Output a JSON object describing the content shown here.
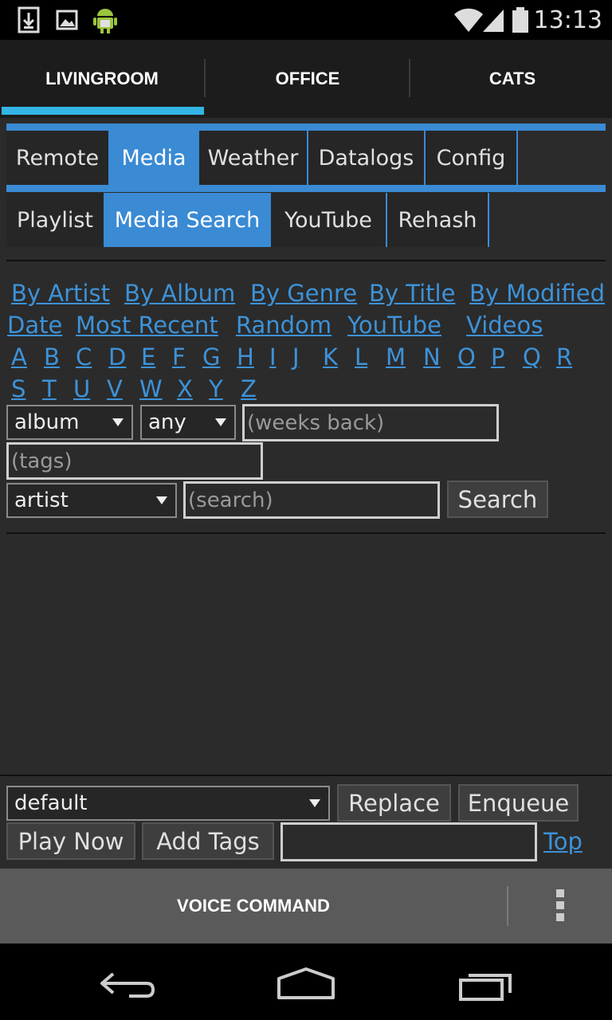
{
  "status_bar": {
    "time": "13:13",
    "left_icons": [
      "download-icon",
      "image-icon",
      "android-icon"
    ],
    "right_icons": [
      "wifi-icon",
      "signal-icon",
      "battery-icon"
    ]
  },
  "rooms": {
    "tabs": [
      "LIVINGROOM",
      "OFFICE",
      "CATS"
    ],
    "selected": "LIVINGROOM"
  },
  "main_tabs": {
    "items": [
      "Remote",
      "Media",
      "Weather",
      "Datalogs",
      "Config"
    ],
    "selected": "Media"
  },
  "sub_tabs": {
    "items": [
      "Playlist",
      "Media Search",
      "YouTube",
      "Rehash"
    ],
    "selected": "Media Search"
  },
  "browse_links": [
    "By Artist",
    "By Album",
    "By Genre",
    "By Title",
    "By Modified",
    "Date",
    "Most Recent",
    "Random",
    "YouTube",
    "Videos"
  ],
  "letters": [
    "A",
    "B",
    "C",
    "D",
    "E",
    "F",
    "G",
    "H",
    "I",
    "J",
    "K",
    "L",
    "M",
    "N",
    "O",
    "P",
    "Q",
    "R",
    "S",
    "T",
    "U",
    "V",
    "W",
    "X",
    "Y",
    "Z"
  ],
  "filters": {
    "type_select": "album",
    "age_select": "any",
    "weeks_placeholder": "(weeks back)",
    "tags_placeholder": "(tags)",
    "field_select": "artist",
    "search_placeholder": "(search)",
    "search_button": "Search"
  },
  "bottom": {
    "playlist_select": "default",
    "replace_button": "Replace",
    "enqueue_button": "Enqueue",
    "play_now_button": "Play Now",
    "add_tags_button": "Add Tags",
    "tags_input_value": "",
    "top_link": "Top"
  },
  "split_bar": {
    "voice_command": "VOICE COMMAND"
  },
  "colors": {
    "accent": "#33b5e5",
    "tab_blue": "#3a8ad4",
    "link": "#3d92d8"
  }
}
